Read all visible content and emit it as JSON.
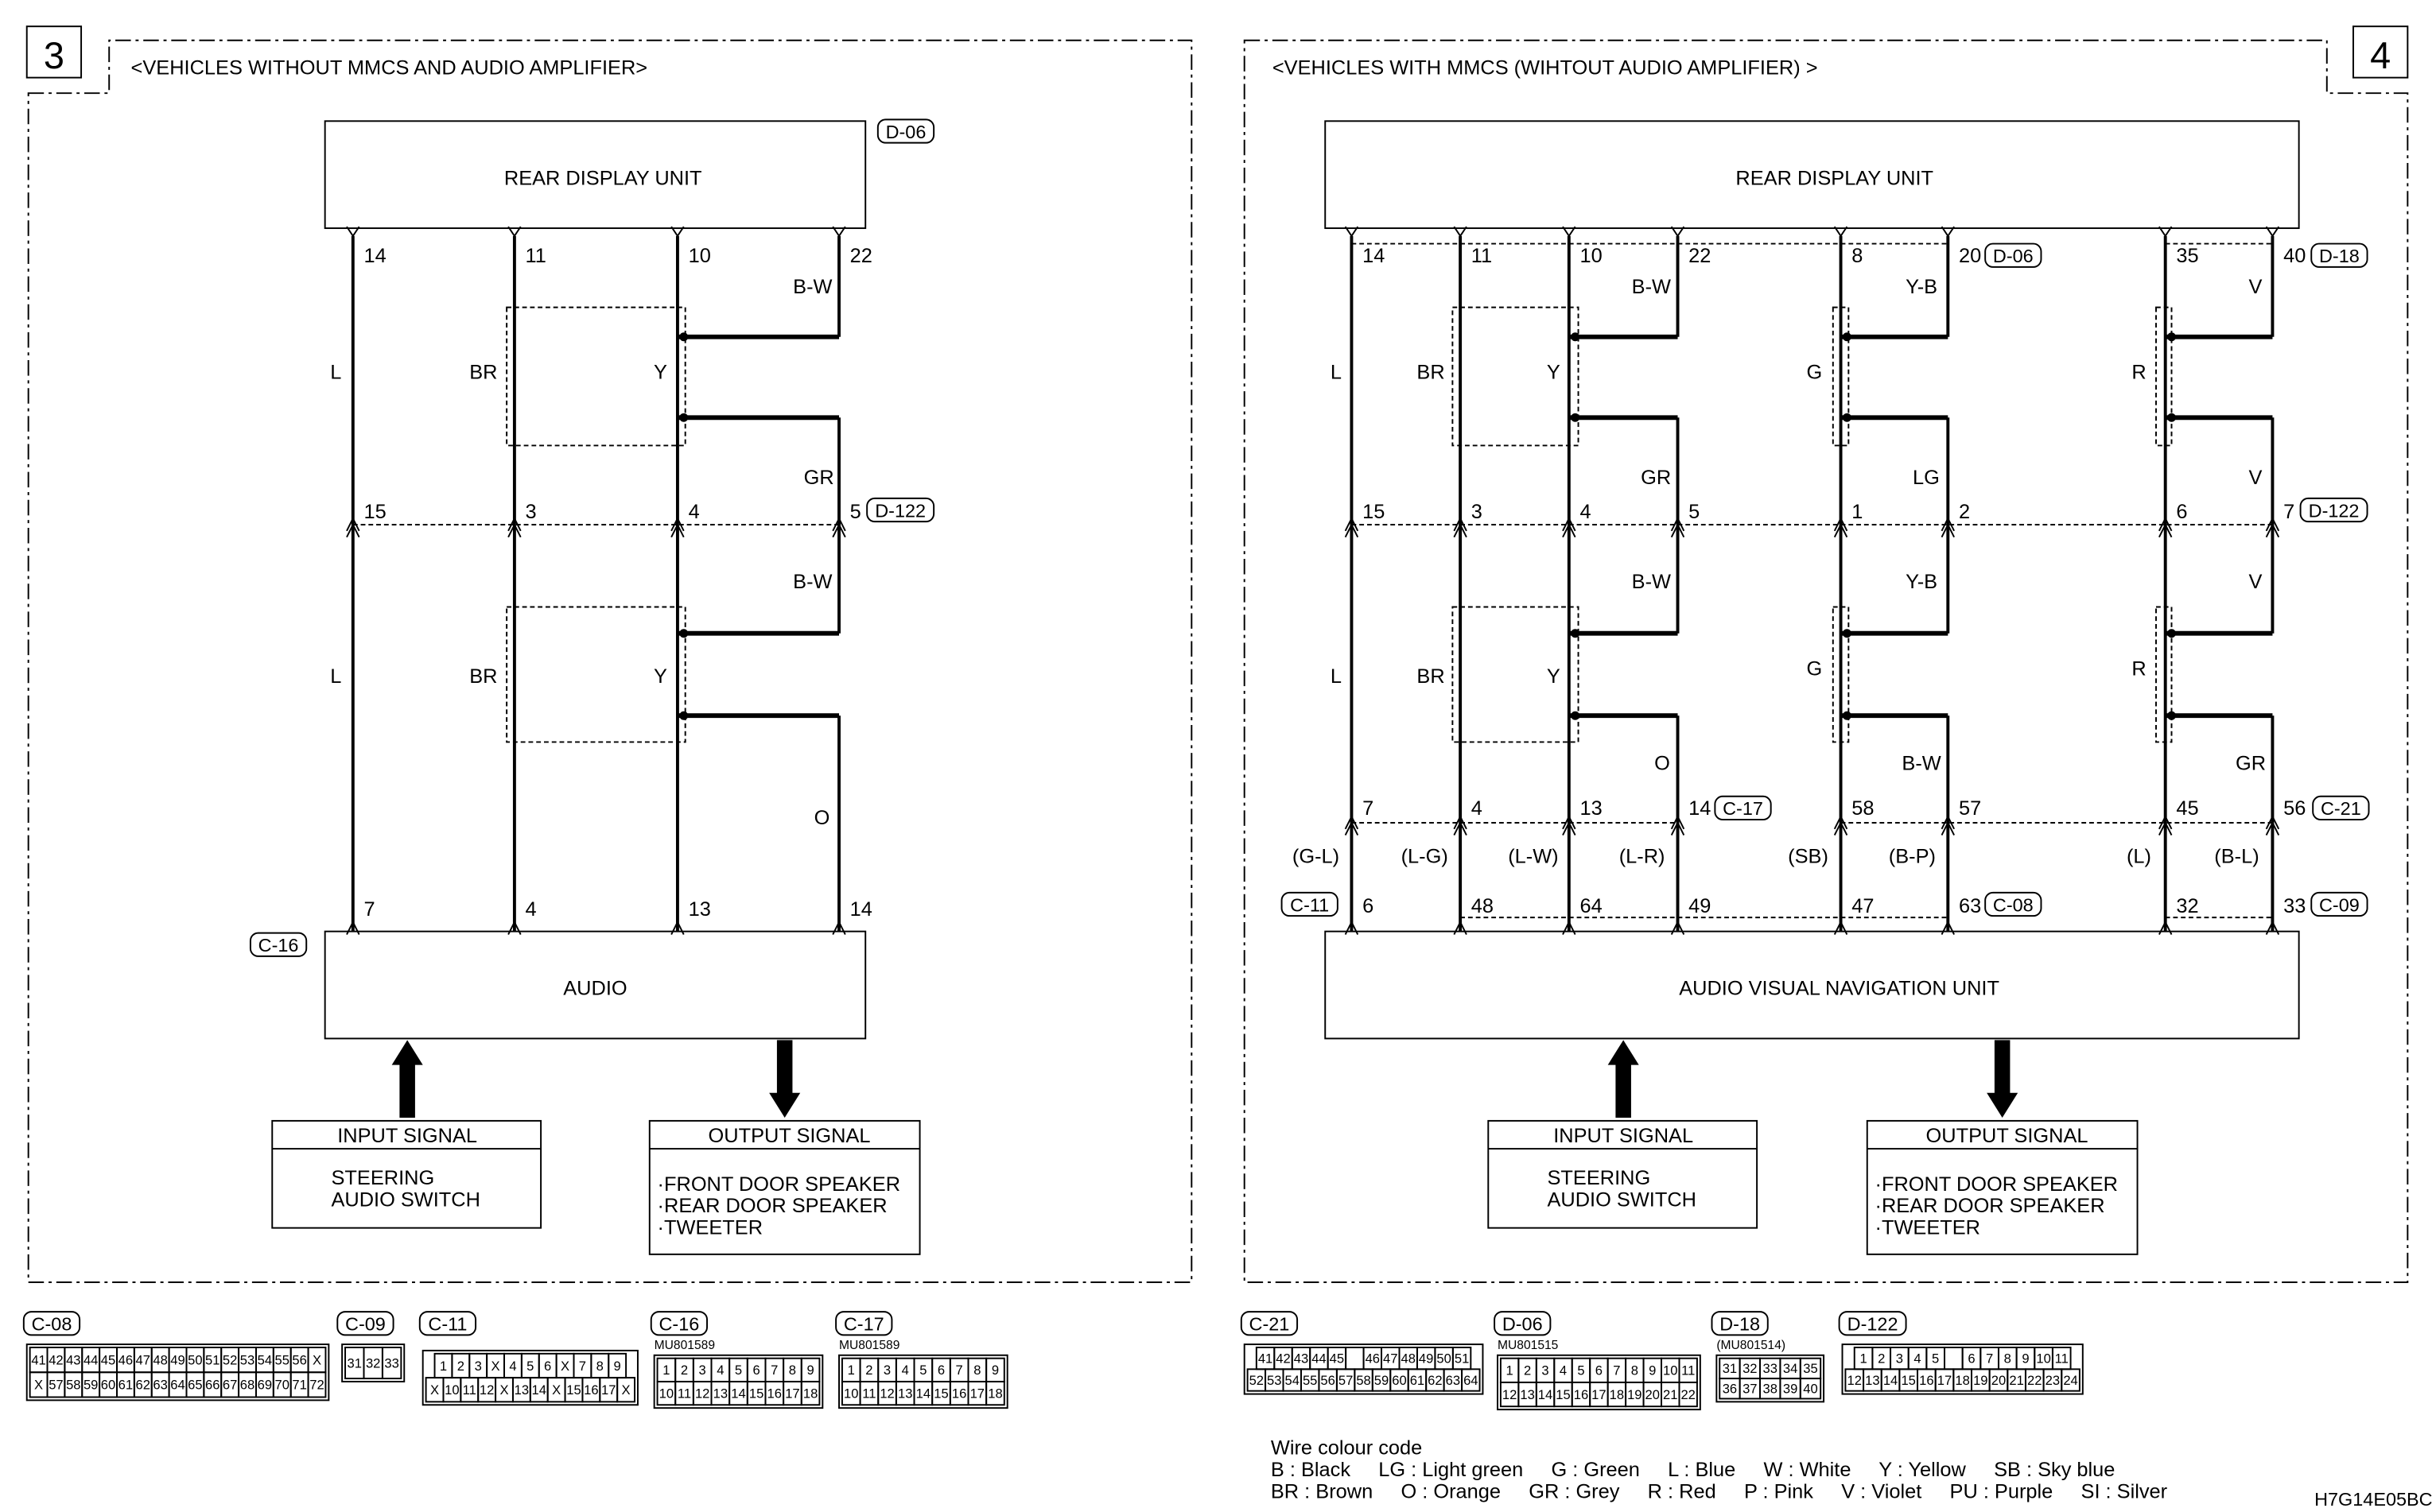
{
  "panels": [
    {
      "number": "3",
      "title": "<VEHICLES WITHOUT MMCS AND AUDIO AMPLIFIER>",
      "top_unit": "REAR DISPLAY UNIT",
      "bottom_unit": "AUDIO",
      "connectors": {
        "top": "D-06",
        "mid": "D-122",
        "bottom": "C-16"
      },
      "top_pins": [
        "14",
        "11",
        "10",
        "22"
      ],
      "mid_pins": [
        "15",
        "3",
        "4",
        "5"
      ],
      "bottom_pins": [
        "7",
        "4",
        "13",
        "14"
      ],
      "wires_upper": [
        "L",
        "BR",
        "Y",
        "B-W",
        "GR"
      ],
      "wires_lower": [
        "L",
        "BR",
        "Y",
        "B-W",
        "O"
      ],
      "input": {
        "title": "INPUT SIGNAL",
        "items": [
          "STEERING",
          "AUDIO SWITCH"
        ]
      },
      "output": {
        "title": "OUTPUT SIGNAL",
        "items": [
          "·FRONT DOOR SPEAKER",
          "·REAR DOOR SPEAKER",
          "·TWEETER"
        ]
      }
    },
    {
      "number": "4",
      "title": "<VEHICLES WITH MMCS (WIHTOUT AUDIO AMPLIFIER) >",
      "top_unit": "REAR DISPLAY UNIT",
      "bottom_unit": "AUDIO VISUAL NAVIGATION UNIT",
      "connectors": {
        "top_a": "D-06",
        "top_b": "D-18",
        "mid": "D-122",
        "lower_a": "C-17",
        "lower_b": "C-21",
        "bottom_a": "C-11",
        "bottom_b": "C-08",
        "bottom_c": "C-09"
      },
      "top_pins": [
        "14",
        "11",
        "10",
        "22",
        "8",
        "20",
        "35",
        "40"
      ],
      "mid_pins": [
        "15",
        "3",
        "4",
        "5",
        "1",
        "2",
        "6",
        "7"
      ],
      "lower_pins": [
        "7",
        "4",
        "13",
        "14",
        "58",
        "57",
        "45",
        "56"
      ],
      "bottom_pins": [
        "6",
        "48",
        "64",
        "49",
        "47",
        "63",
        "32",
        "33"
      ],
      "wires_upper": [
        "L",
        "BR",
        "Y",
        "B-W",
        "GR",
        "G",
        "Y-B",
        "LG",
        "R",
        "V",
        "V"
      ],
      "wires_lower": [
        "L",
        "BR",
        "Y",
        "B-W",
        "O",
        "G",
        "Y-B",
        "B-W",
        "R",
        "V",
        "GR"
      ],
      "harness_wires": [
        "(G-L)",
        "(L-G)",
        "(L-W)",
        "(L-R)",
        "(SB)",
        "(B-P)",
        "(L)",
        "(B-L)"
      ],
      "input": {
        "title": "INPUT SIGNAL",
        "items": [
          "STEERING",
          "AUDIO SWITCH"
        ]
      },
      "output": {
        "title": "OUTPUT SIGNAL",
        "items": [
          "·FRONT DOOR SPEAKER",
          "·REAR DOOR SPEAKER",
          "·TWEETER"
        ]
      }
    }
  ],
  "connector_views": [
    {
      "id": "C-08",
      "part": "",
      "rows": [
        [
          "41",
          "42",
          "43",
          "44",
          "45",
          "46",
          "47",
          "48",
          "49",
          "50",
          "51",
          "52",
          "53",
          "54",
          "55",
          "56",
          "X"
        ],
        [
          "X",
          "57",
          "58",
          "59",
          "60",
          "61",
          "62",
          "63",
          "64",
          "65",
          "66",
          "67",
          "68",
          "69",
          "70",
          "71",
          "72"
        ]
      ]
    },
    {
      "id": "C-09",
      "part": "",
      "rows": [
        [
          "31",
          "32",
          "33"
        ]
      ]
    },
    {
      "id": "C-11",
      "part": "",
      "rows": [
        [
          "1",
          "2",
          "3",
          "X",
          "4",
          "5",
          "6",
          "X",
          "7",
          "8",
          "9"
        ],
        [
          "X",
          "10",
          "11",
          "12",
          "X",
          "13",
          "14",
          "X",
          "15",
          "16",
          "17",
          "X"
        ]
      ]
    },
    {
      "id": "C-16",
      "part": "MU801589",
      "rows": [
        [
          "1",
          "2",
          "3",
          "4",
          "5",
          "6",
          "7",
          "8",
          "9"
        ],
        [
          "10",
          "11",
          "12",
          "13",
          "14",
          "15",
          "16",
          "17",
          "18"
        ]
      ]
    },
    {
      "id": "C-17",
      "part": "MU801589",
      "rows": [
        [
          "1",
          "2",
          "3",
          "4",
          "5",
          "6",
          "7",
          "8",
          "9"
        ],
        [
          "10",
          "11",
          "12",
          "13",
          "14",
          "15",
          "16",
          "17",
          "18"
        ]
      ]
    },
    {
      "id": "C-21",
      "part": "",
      "rows": [
        [
          "41",
          "42",
          "43",
          "44",
          "45",
          "",
          "46",
          "47",
          "48",
          "49",
          "50",
          "51"
        ],
        [
          "52",
          "53",
          "54",
          "55",
          "56",
          "57",
          "58",
          "59",
          "60",
          "61",
          "62",
          "63",
          "64"
        ]
      ]
    },
    {
      "id": "D-06",
      "part": "MU801515",
      "rows": [
        [
          "1",
          "2",
          "3",
          "4",
          "5",
          "6",
          "7",
          "8",
          "9",
          "10",
          "11"
        ],
        [
          "12",
          "13",
          "14",
          "15",
          "16",
          "17",
          "18",
          "19",
          "20",
          "21",
          "22"
        ]
      ]
    },
    {
      "id": "D-18",
      "part": "(MU801514)",
      "rows": [
        [
          "31",
          "32",
          "33",
          "34",
          "35"
        ],
        [
          "36",
          "37",
          "38",
          "39",
          "40"
        ]
      ]
    },
    {
      "id": "D-122",
      "part": "",
      "rows": [
        [
          "1",
          "2",
          "3",
          "4",
          "5",
          "",
          "6",
          "7",
          "8",
          "9",
          "10",
          "11"
        ],
        [
          "12",
          "13",
          "14",
          "15",
          "16",
          "17",
          "18",
          "19",
          "20",
          "21",
          "22",
          "23",
          "24"
        ]
      ]
    }
  ],
  "legend": {
    "title": "Wire colour code",
    "lines": [
      "B : Black     LG : Light green     G : Green     L : Blue     W : White     Y : Yellow     SB : Sky blue",
      "BR : Brown     O : Orange     GR : Grey     R : Red     P : Pink     V : Violet     PU : Purple     SI : Silver"
    ]
  },
  "drawing_id": "H7G14E05BC"
}
